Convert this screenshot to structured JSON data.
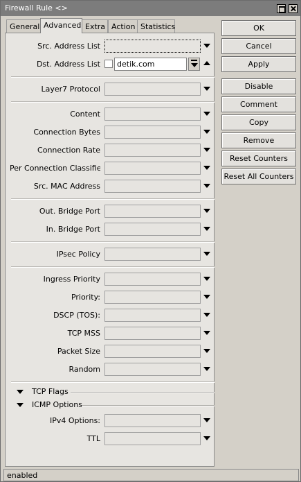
{
  "window": {
    "title": "Firewall Rule <>"
  },
  "tabs": [
    "General",
    "Advanced",
    "Extra",
    "Action",
    "Statistics"
  ],
  "active_tab": "Advanced",
  "fields": {
    "src_address_list": {
      "label": "Src. Address List",
      "value": ""
    },
    "dst_address_list": {
      "label": "Dst. Address List",
      "value": "detik.com",
      "negate_checked": false
    },
    "layer7_protocol": {
      "label": "Layer7 Protocol",
      "value": ""
    },
    "content": {
      "label": "Content",
      "value": ""
    },
    "connection_bytes": {
      "label": "Connection Bytes",
      "value": ""
    },
    "connection_rate": {
      "label": "Connection Rate",
      "value": ""
    },
    "per_connection_classifier": {
      "label": "Per Connection Classifier",
      "value": ""
    },
    "src_mac_address": {
      "label": "Src. MAC Address",
      "value": ""
    },
    "out_bridge_port": {
      "label": "Out. Bridge Port",
      "value": ""
    },
    "in_bridge_port": {
      "label": "In. Bridge Port",
      "value": ""
    },
    "ipsec_policy": {
      "label": "IPsec Policy",
      "value": ""
    },
    "ingress_priority": {
      "label": "Ingress Priority",
      "value": ""
    },
    "priority": {
      "label": "Priority:",
      "value": ""
    },
    "dscp": {
      "label": "DSCP (TOS):",
      "value": ""
    },
    "tcp_mss": {
      "label": "TCP MSS",
      "value": ""
    },
    "packet_size": {
      "label": "Packet Size",
      "value": ""
    },
    "random": {
      "label": "Random",
      "value": ""
    },
    "ipv4_options": {
      "label": "IPv4 Options:",
      "value": ""
    },
    "ttl": {
      "label": "TTL",
      "value": ""
    }
  },
  "sections": {
    "tcp_flags": "TCP Flags",
    "icmp_options": "ICMP Options"
  },
  "buttons": {
    "ok": "OK",
    "cancel": "Cancel",
    "apply": "Apply",
    "disable": "Disable",
    "comment": "Comment",
    "copy": "Copy",
    "remove": "Remove",
    "reset_counters": "Reset Counters",
    "reset_all_counters": "Reset All Counters"
  },
  "status": "enabled"
}
